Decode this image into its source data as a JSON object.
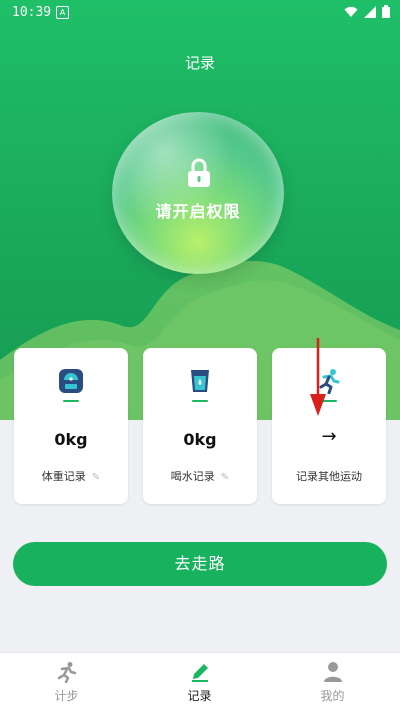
{
  "status_bar": {
    "time": "10:39",
    "notification_letter": "A"
  },
  "page": {
    "title": "记录"
  },
  "permission": {
    "text": "请开启权限",
    "icon": "lock-icon"
  },
  "cards": [
    {
      "icon": "weight-scale-icon",
      "value": "0kg",
      "label": "体重记录",
      "edit_icon": "pencil-icon"
    },
    {
      "icon": "water-cup-icon",
      "value": "0kg",
      "label": "喝水记录",
      "edit_icon": "pencil-icon"
    },
    {
      "icon": "running-icon",
      "arrow": "→",
      "label": "记录其他运动"
    }
  ],
  "go_button": {
    "label": "去走路"
  },
  "tabs": [
    {
      "label": "计步",
      "icon": "walking-icon",
      "active": false
    },
    {
      "label": "记录",
      "icon": "pencil-icon",
      "active": true
    },
    {
      "label": "我的",
      "icon": "person-icon",
      "active": false
    }
  ],
  "colors": {
    "primary": "#1ab760",
    "header": "#1fbf68",
    "hill": "#a8dc76",
    "annotation": "#d9211c"
  }
}
